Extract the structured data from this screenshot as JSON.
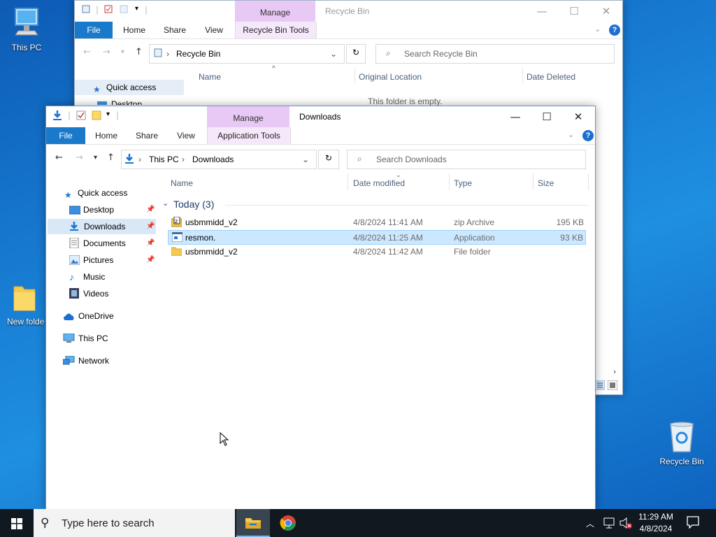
{
  "desktop": {
    "icons": [
      {
        "label": "This PC"
      },
      {
        "label": "New folde"
      },
      {
        "label": "Recycle Bin"
      }
    ]
  },
  "recycle_window": {
    "manage_label": "Manage",
    "title": "Recycle Bin",
    "tabs": [
      "File",
      "Home",
      "Share",
      "View",
      "Recycle Bin Tools"
    ],
    "address": "Recycle Bin",
    "search_placeholder": "Search Recycle Bin",
    "columns": [
      "Name",
      "Original Location",
      "Date Deleted"
    ],
    "empty_text": "This folder is empty.",
    "nav": [
      "Quick access",
      "Desktop"
    ]
  },
  "downloads_window": {
    "manage_label": "Manage",
    "title": "Downloads",
    "tabs": [
      "File",
      "Home",
      "Share",
      "View",
      "Application Tools"
    ],
    "address": {
      "root": "This PC",
      "current": "Downloads"
    },
    "search_placeholder": "Search Downloads",
    "columns": [
      "Name",
      "Date modified",
      "Type",
      "Size"
    ],
    "group_label": "Today (3)",
    "files": [
      {
        "name": "usbmmidd_v2",
        "date": "4/8/2024 11:41 AM",
        "type": "zip Archive",
        "size": "195 KB",
        "icon": "zip-icon",
        "selected": false
      },
      {
        "name": "resmon.",
        "date": "4/8/2024 11:25 AM",
        "type": "Application",
        "size": "93 KB",
        "icon": "app-icon",
        "selected": true
      },
      {
        "name": "usbmmidd_v2",
        "date": "4/8/2024 11:42 AM",
        "type": "File folder",
        "size": "",
        "icon": "folder-icon",
        "selected": false
      }
    ],
    "nav": {
      "quick_access": "Quick access",
      "desktop": "Desktop",
      "downloads": "Downloads",
      "documents": "Documents",
      "pictures": "Pictures",
      "music": "Music",
      "videos": "Videos",
      "onedrive": "OneDrive",
      "thispc": "This PC",
      "network": "Network"
    }
  },
  "taskbar": {
    "search_placeholder": "Type here to search",
    "time": "11:29 AM",
    "date": "4/8/2024"
  },
  "colors": {
    "file_tab": "#1979ca",
    "manage_tab": "#e8c8f5",
    "selection": "#cce8ff",
    "taskbar": "#101820"
  }
}
